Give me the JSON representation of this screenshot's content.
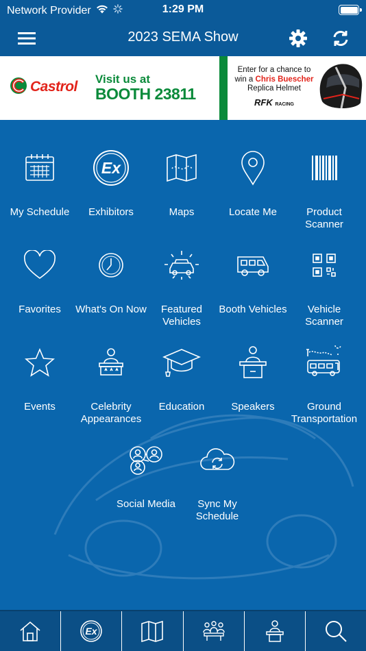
{
  "status_bar": {
    "carrier": "Network Provider",
    "time": "1:29 PM"
  },
  "header": {
    "title": "2023 SEMA Show",
    "menu_icon": "hamburger-icon",
    "settings_icon": "gear-icon",
    "refresh_icon": "refresh-icon"
  },
  "banner": {
    "brand": "Castrol",
    "visit_line": "Visit us at",
    "booth_line": "BOOTH 23811",
    "promo_line1": "Enter for a chance to",
    "promo_line2_prefix": "win a ",
    "promo_name": "Chris Buescher",
    "promo_line3": "Replica Helmet",
    "sponsor_logo": "RFK",
    "sponsor_sub": "RACING"
  },
  "tiles": [
    {
      "label": "My Schedule",
      "icon": "calendar-icon"
    },
    {
      "label": "Exhibitors",
      "icon": "exhibitors-icon"
    },
    {
      "label": "Maps",
      "icon": "map-icon"
    },
    {
      "label": "Locate Me",
      "icon": "location-pin-icon"
    },
    {
      "label": "Product Scanner",
      "icon": "barcode-icon"
    },
    {
      "label": "Favorites",
      "icon": "heart-icon"
    },
    {
      "label": "What's On Now",
      "icon": "clock-icon"
    },
    {
      "label": "Featured Vehicles",
      "icon": "featured-car-icon"
    },
    {
      "label": "Booth Vehicles",
      "icon": "van-icon"
    },
    {
      "label": "Vehicle Scanner",
      "icon": "qr-code-icon"
    },
    {
      "label": "Events",
      "icon": "star-icon"
    },
    {
      "label": "Celebrity Appearances",
      "icon": "podium-icon"
    },
    {
      "label": "Education",
      "icon": "graduation-cap-icon"
    },
    {
      "label": "Speakers",
      "icon": "speaker-lectern-icon"
    },
    {
      "label": "Ground Transportation",
      "icon": "bus-icon"
    },
    {
      "label": "Social Media",
      "icon": "social-people-icon"
    },
    {
      "label": "Sync My Schedule",
      "icon": "cloud-sync-icon"
    }
  ],
  "tab_bar": [
    {
      "icon": "home-icon"
    },
    {
      "icon": "exhibitors-icon"
    },
    {
      "icon": "map-icon"
    },
    {
      "icon": "people-meeting-icon"
    },
    {
      "icon": "speaker-lectern-icon"
    },
    {
      "icon": "search-icon"
    }
  ],
  "colors": {
    "background": "#0a66ad",
    "header": "#0b5a99",
    "tab_bar": "#0b4f86",
    "castrol_green": "#0a8a3a",
    "castrol_red": "#e2231a"
  }
}
